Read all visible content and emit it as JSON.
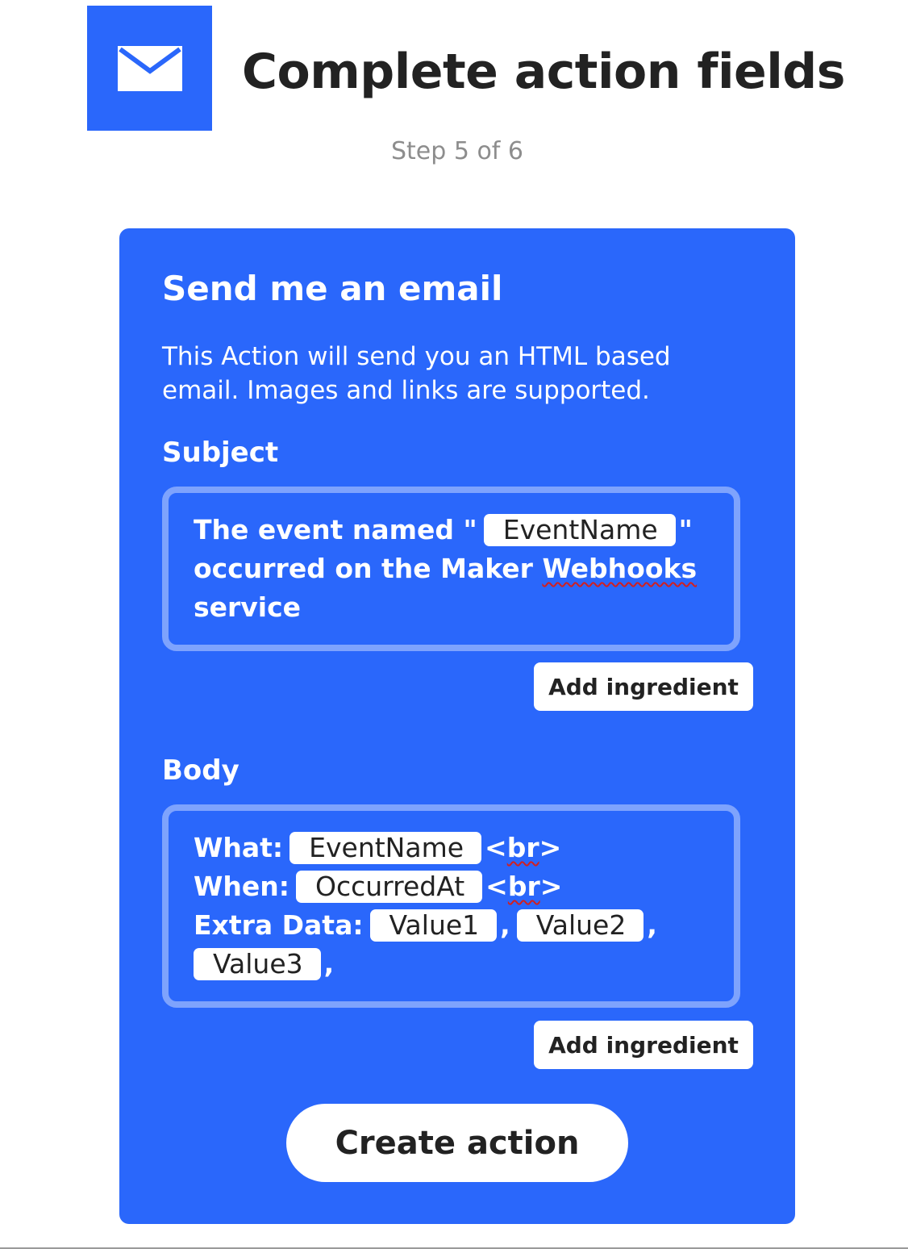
{
  "header": {
    "icon": "envelope-icon",
    "title": "Complete action fields",
    "step": "Step 5 of 6"
  },
  "card": {
    "title": "Send me an email",
    "description": "This Action will send you an HTML based email. Images and links are supported.",
    "subject": {
      "label": "Subject",
      "text_before": "The event named \"",
      "ingredient": "EventName",
      "text_quote": "\"",
      "text_after_1": "occurred on the Maker ",
      "text_flagged": "Webhooks",
      "text_after_2": "service",
      "add_ingredient_label": "Add ingredient"
    },
    "body": {
      "label": "Body",
      "what_label": "What:",
      "what_ingredient": "EventName",
      "when_label": "When:",
      "when_ingredient": "OccurredAt",
      "br_lt": "<",
      "br_tag": "br",
      "br_gt": ">",
      "extra_label": "Extra Data:",
      "value1": "Value1",
      "value2": "Value2",
      "value3": "Value3",
      "comma": ",",
      "add_ingredient_label": "Add ingredient"
    },
    "create_label": "Create action"
  },
  "colors": {
    "brand_blue": "#2a67fb",
    "field_border": "#7ea3fd",
    "title_text": "#222222",
    "step_text": "#8d8d8d",
    "spellcheck": "#d02020"
  }
}
